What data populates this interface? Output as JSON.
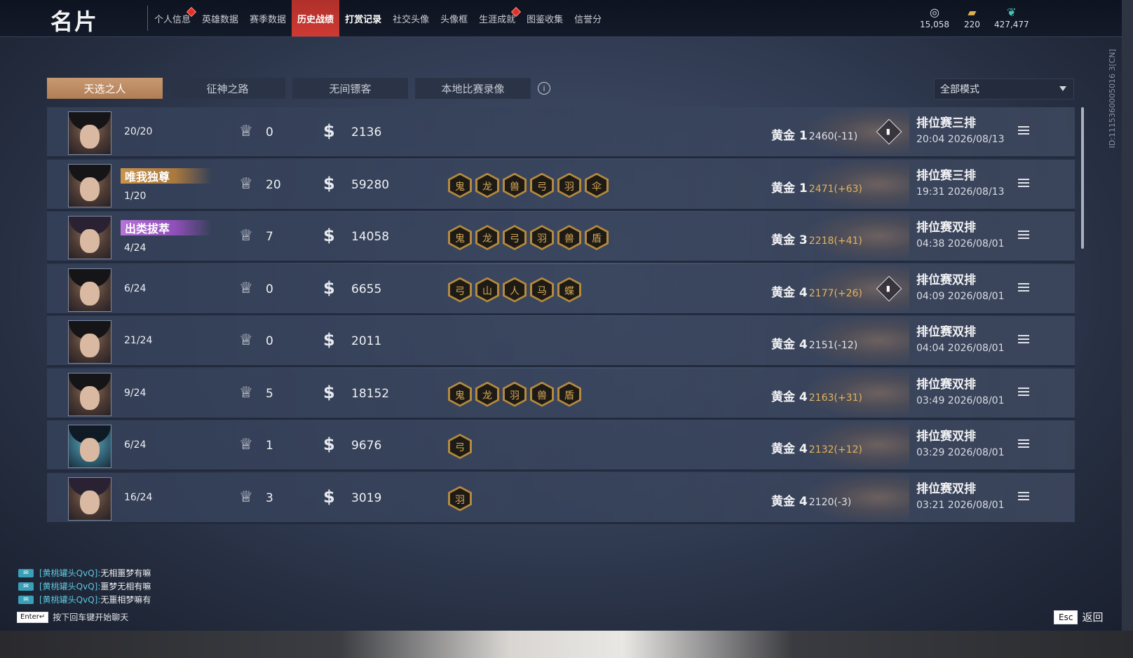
{
  "header": {
    "title": "名片",
    "nav": [
      {
        "label": "个人信息",
        "dot": true
      },
      {
        "label": "英雄数据"
      },
      {
        "label": "赛季数据"
      },
      {
        "label": "历史战绩",
        "active": true
      },
      {
        "label": "打赏记录",
        "bold": true
      },
      {
        "label": "社交头像"
      },
      {
        "label": "头像框"
      },
      {
        "label": "生涯成就",
        "dot": true
      },
      {
        "label": "图鉴收集"
      },
      {
        "label": "信誉分"
      }
    ],
    "currencies": [
      {
        "icon": "coin-stack-icon",
        "value": "15,058"
      },
      {
        "icon": "gold-ticket-icon",
        "value": "220"
      },
      {
        "icon": "jade-feather-icon",
        "value": "427,477"
      }
    ]
  },
  "tabs": [
    "天选之人",
    "征神之路",
    "无间镖客",
    "本地比赛录像"
  ],
  "mode_select": {
    "value": "全部模式"
  },
  "vertical_id": "ID:1115360005016 3[CN]",
  "rows": [
    {
      "title": "",
      "rank": "20/20",
      "kills": "0",
      "gold": "2136",
      "items": [],
      "tier": "黄金 1",
      "score": "2460(-11)",
      "up": false,
      "mvp": true,
      "mode": "排位赛三排",
      "time": "20:04  2026/08/13"
    },
    {
      "title": "唯我独尊",
      "title_style": "gold",
      "rank": "1/20",
      "kills": "20",
      "gold": "59280",
      "items": [
        "鬼",
        "龙",
        "兽",
        "弓",
        "羽",
        "伞"
      ],
      "tier": "黄金 1",
      "score": "2471(+63)",
      "up": true,
      "mvp": false,
      "mode": "排位赛三排",
      "time": "19:31  2026/08/13"
    },
    {
      "title": "出类拔萃",
      "title_style": "purple",
      "rank": "4/24",
      "kills": "7",
      "gold": "14058",
      "items": [
        "鬼",
        "龙",
        "弓",
        "羽",
        "兽",
        "盾"
      ],
      "tier": "黄金 3",
      "score": "2218(+41)",
      "up": true,
      "mvp": false,
      "mode": "排位赛双排",
      "time": "04:38  2026/08/01"
    },
    {
      "title": "",
      "rank": "6/24",
      "kills": "0",
      "gold": "6655",
      "items": [
        "弓",
        "山",
        "人",
        "马",
        "蝶"
      ],
      "tier": "黄金 4",
      "score": "2177(+26)",
      "up": true,
      "mvp": true,
      "mode": "排位赛双排",
      "time": "04:09  2026/08/01"
    },
    {
      "title": "",
      "rank": "21/24",
      "kills": "0",
      "gold": "2011",
      "items": [],
      "tier": "黄金 4",
      "score": "2151(-12)",
      "up": false,
      "mvp": false,
      "mode": "排位赛双排",
      "time": "04:04  2026/08/01"
    },
    {
      "title": "",
      "rank": "9/24",
      "kills": "5",
      "gold": "18152",
      "items": [
        "鬼",
        "龙",
        "羽",
        "兽",
        "盾"
      ],
      "tier": "黄金 4",
      "score": "2163(+31)",
      "up": true,
      "mvp": false,
      "mode": "排位赛双排",
      "time": "03:49  2026/08/01"
    },
    {
      "title": "",
      "rank": "6/24",
      "kills": "1",
      "gold": "9676",
      "items": [
        "弓"
      ],
      "tier": "黄金 4",
      "score": "2132(+12)",
      "up": true,
      "mvp": false,
      "mode": "排位赛双排",
      "time": "03:29  2026/08/01"
    },
    {
      "title": "",
      "rank": "16/24",
      "kills": "3",
      "gold": "3019",
      "items": [
        "羽"
      ],
      "tier": "黄金 4",
      "score": "2120(-3)",
      "up": false,
      "mvp": false,
      "mode": "排位赛双排",
      "time": "03:21  2026/08/01"
    }
  ],
  "chat": [
    {
      "name": "[黄桃罐头QvQ]:",
      "msg": "无相噩梦有嘛"
    },
    {
      "name": "[黄桃罐头QvQ]:",
      "msg": "噩梦无相有嘛"
    },
    {
      "name": "[黄桃罐头QvQ]:",
      "msg": "无噩相梦嘛有"
    }
  ],
  "chat_hint": {
    "key": "Enter↵",
    "text": "按下回车键开始聊天"
  },
  "esc": {
    "key": "Esc",
    "label": "返回"
  }
}
